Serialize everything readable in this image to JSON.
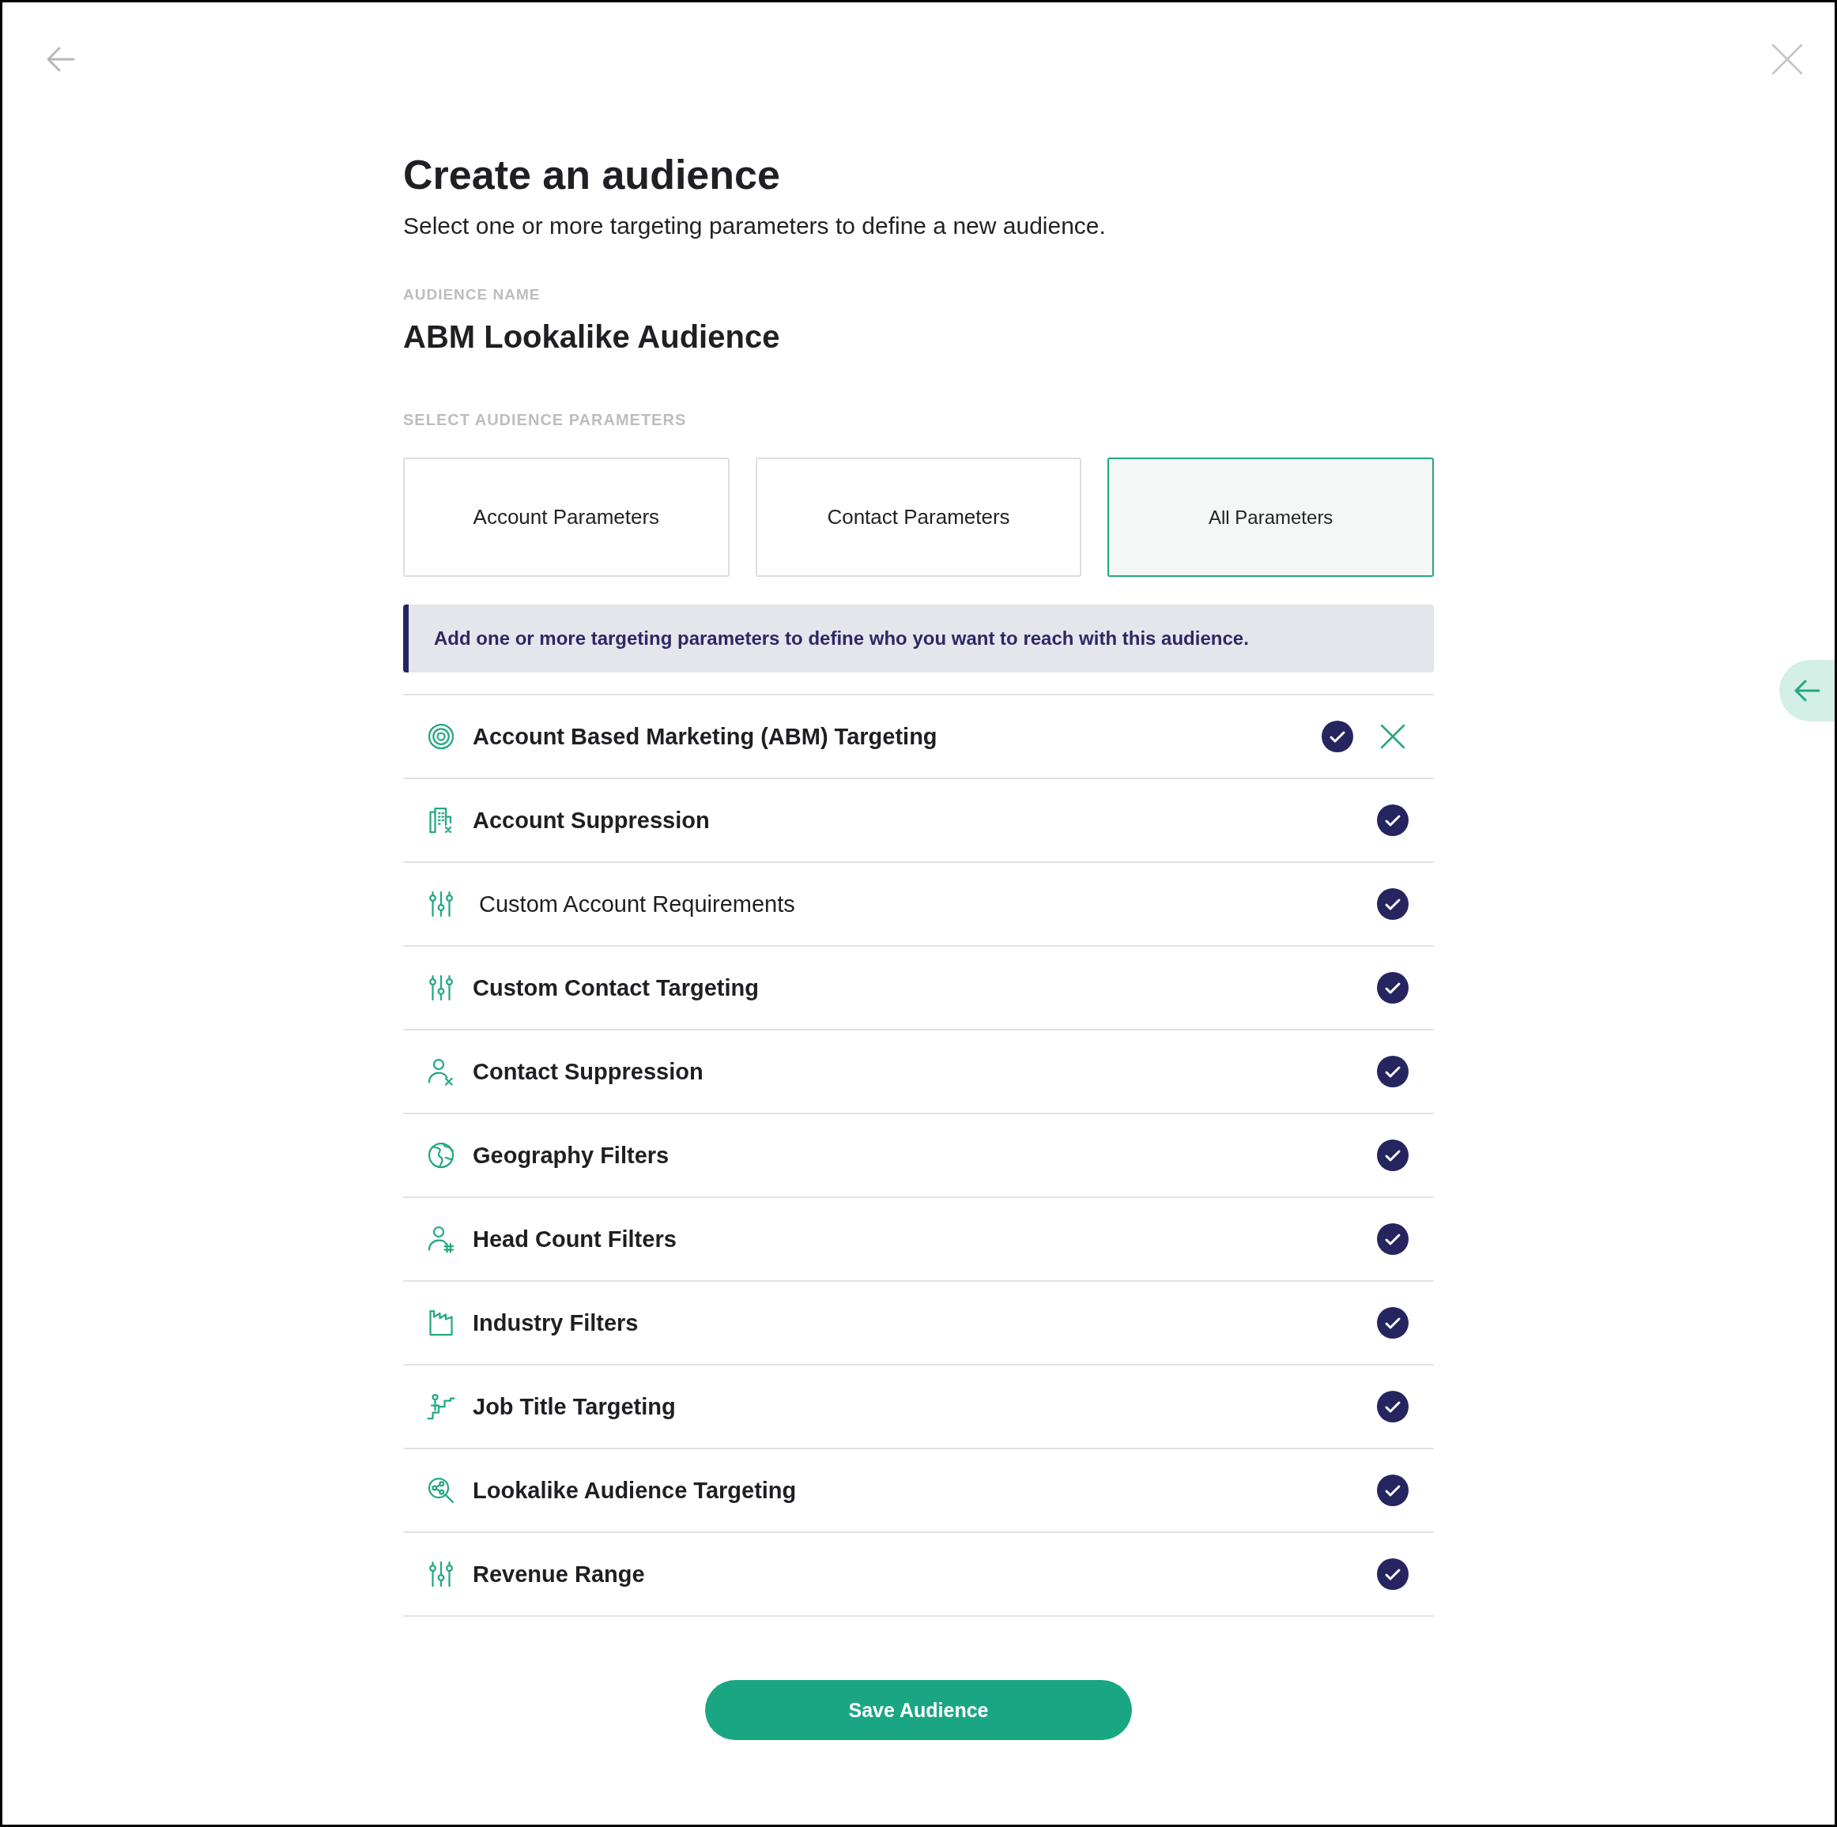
{
  "title": "Create an audience",
  "subtitle": "Select one or more targeting parameters to define a new audience.",
  "audience_name": {
    "label": "AUDIENCE NAME",
    "value": "ABM Lookalike Audience"
  },
  "parameters_label": "SELECT AUDIENCE PARAMETERS",
  "tabs": [
    {
      "label": "Account Parameters",
      "selected": false
    },
    {
      "label": "Contact Parameters",
      "selected": false
    },
    {
      "label": "All Parameters",
      "selected": true
    }
  ],
  "notice": "Add one or more targeting parameters to define who you want to reach with this audience.",
  "parameters": [
    {
      "label": "Account Based Marketing (ABM) Targeting",
      "checked": true,
      "removable": true,
      "bold": true
    },
    {
      "label": "Account Suppression",
      "checked": true,
      "removable": false,
      "bold": true
    },
    {
      "label": "Custom Account Requirements",
      "checked": true,
      "removable": false,
      "bold": false
    },
    {
      "label": "Custom Contact Targeting",
      "checked": true,
      "removable": false,
      "bold": true
    },
    {
      "label": "Contact Suppression",
      "checked": true,
      "removable": false,
      "bold": true
    },
    {
      "label": "Geography Filters",
      "checked": true,
      "removable": false,
      "bold": true
    },
    {
      "label": "Head Count  Filters",
      "checked": true,
      "removable": false,
      "bold": true
    },
    {
      "label": "Industry Filters",
      "checked": true,
      "removable": false,
      "bold": true
    },
    {
      "label": "Job Title Targeting",
      "checked": true,
      "removable": false,
      "bold": true
    },
    {
      "label": "Lookalike Audience Targeting",
      "checked": true,
      "removable": false,
      "bold": true
    },
    {
      "label": "Revenue Range",
      "checked": true,
      "removable": false,
      "bold": true
    }
  ],
  "save_button": "Save Audience"
}
